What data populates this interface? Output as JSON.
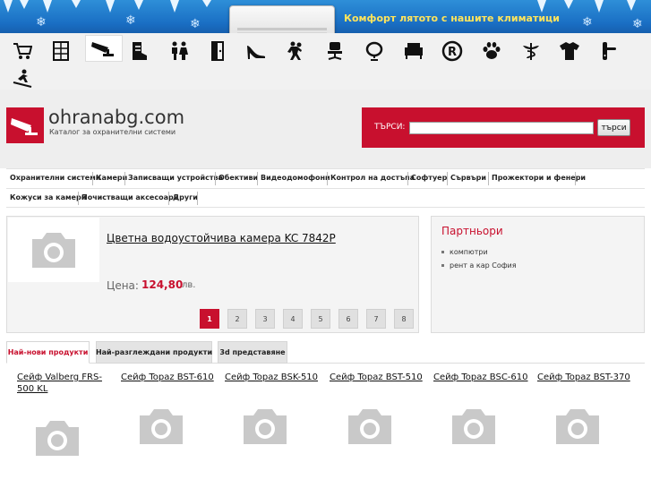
{
  "banner": {
    "text": "Комфорт лятото с нашите климатици"
  },
  "categories": [
    {
      "name": "cart-icon"
    },
    {
      "name": "safe-icon"
    },
    {
      "name": "security-camera-icon",
      "active": true
    },
    {
      "name": "boot-icon"
    },
    {
      "name": "people-icon"
    },
    {
      "name": "door-icon"
    },
    {
      "name": "high-heel-icon"
    },
    {
      "name": "dancers-icon"
    },
    {
      "name": "office-chair-icon"
    },
    {
      "name": "mirror-icon"
    },
    {
      "name": "armchair-icon"
    },
    {
      "name": "registered-icon"
    },
    {
      "name": "paw-icon"
    },
    {
      "name": "caduceus-icon"
    },
    {
      "name": "tshirt-icon"
    },
    {
      "name": "door-handle-icon"
    },
    {
      "name": "skier-icon"
    }
  ],
  "header": {
    "site_name": "ohranabg.com",
    "tagline": "Каталог за охранителни системи",
    "logo_icon": "security-camera-icon"
  },
  "search": {
    "label": "ТЪРСИ:",
    "value": "",
    "placeholder": "",
    "button": "търси"
  },
  "nav": {
    "row1": [
      "Охранителни системи",
      "Камери",
      "Записващи устройства",
      "Обективи",
      "Видеодомофони",
      "Контрол на достъпа",
      "Софтуер",
      "Сървъри",
      "Прожектори и фенери"
    ],
    "row2": [
      "Кожуси за камери",
      "Почистващи аксесоари",
      "Други"
    ]
  },
  "featured": {
    "title": "Цветна водоустойчива камера KC 7842P",
    "price_label": "Цена:",
    "price": "124,80",
    "currency": "лв.",
    "pages": [
      "1",
      "2",
      "3",
      "4",
      "5",
      "6",
      "7",
      "8"
    ],
    "active_page": "1"
  },
  "partners": {
    "title": "Партньори",
    "items": [
      "компютри",
      "рент а кар София"
    ]
  },
  "tabs": [
    {
      "label": "Най-нови продукти",
      "active": true
    },
    {
      "label": "Най-разглеждани продукти",
      "active": false
    },
    {
      "label": "3d представяне",
      "active": false
    }
  ],
  "products": [
    {
      "name": "Сейф Valberg FRS-500 KL"
    },
    {
      "name": "Сейф Topaz BST-610"
    },
    {
      "name": "Сейф Topaz BSK-510"
    },
    {
      "name": "Сейф Topaz BST-510"
    },
    {
      "name": "Сейф Topaz BSC-610"
    },
    {
      "name": "Сейф Topaz BST-370"
    }
  ],
  "colors": {
    "accent": "#c8102e",
    "banner": "#1a6fc4",
    "banner_text": "#ffe45c"
  }
}
